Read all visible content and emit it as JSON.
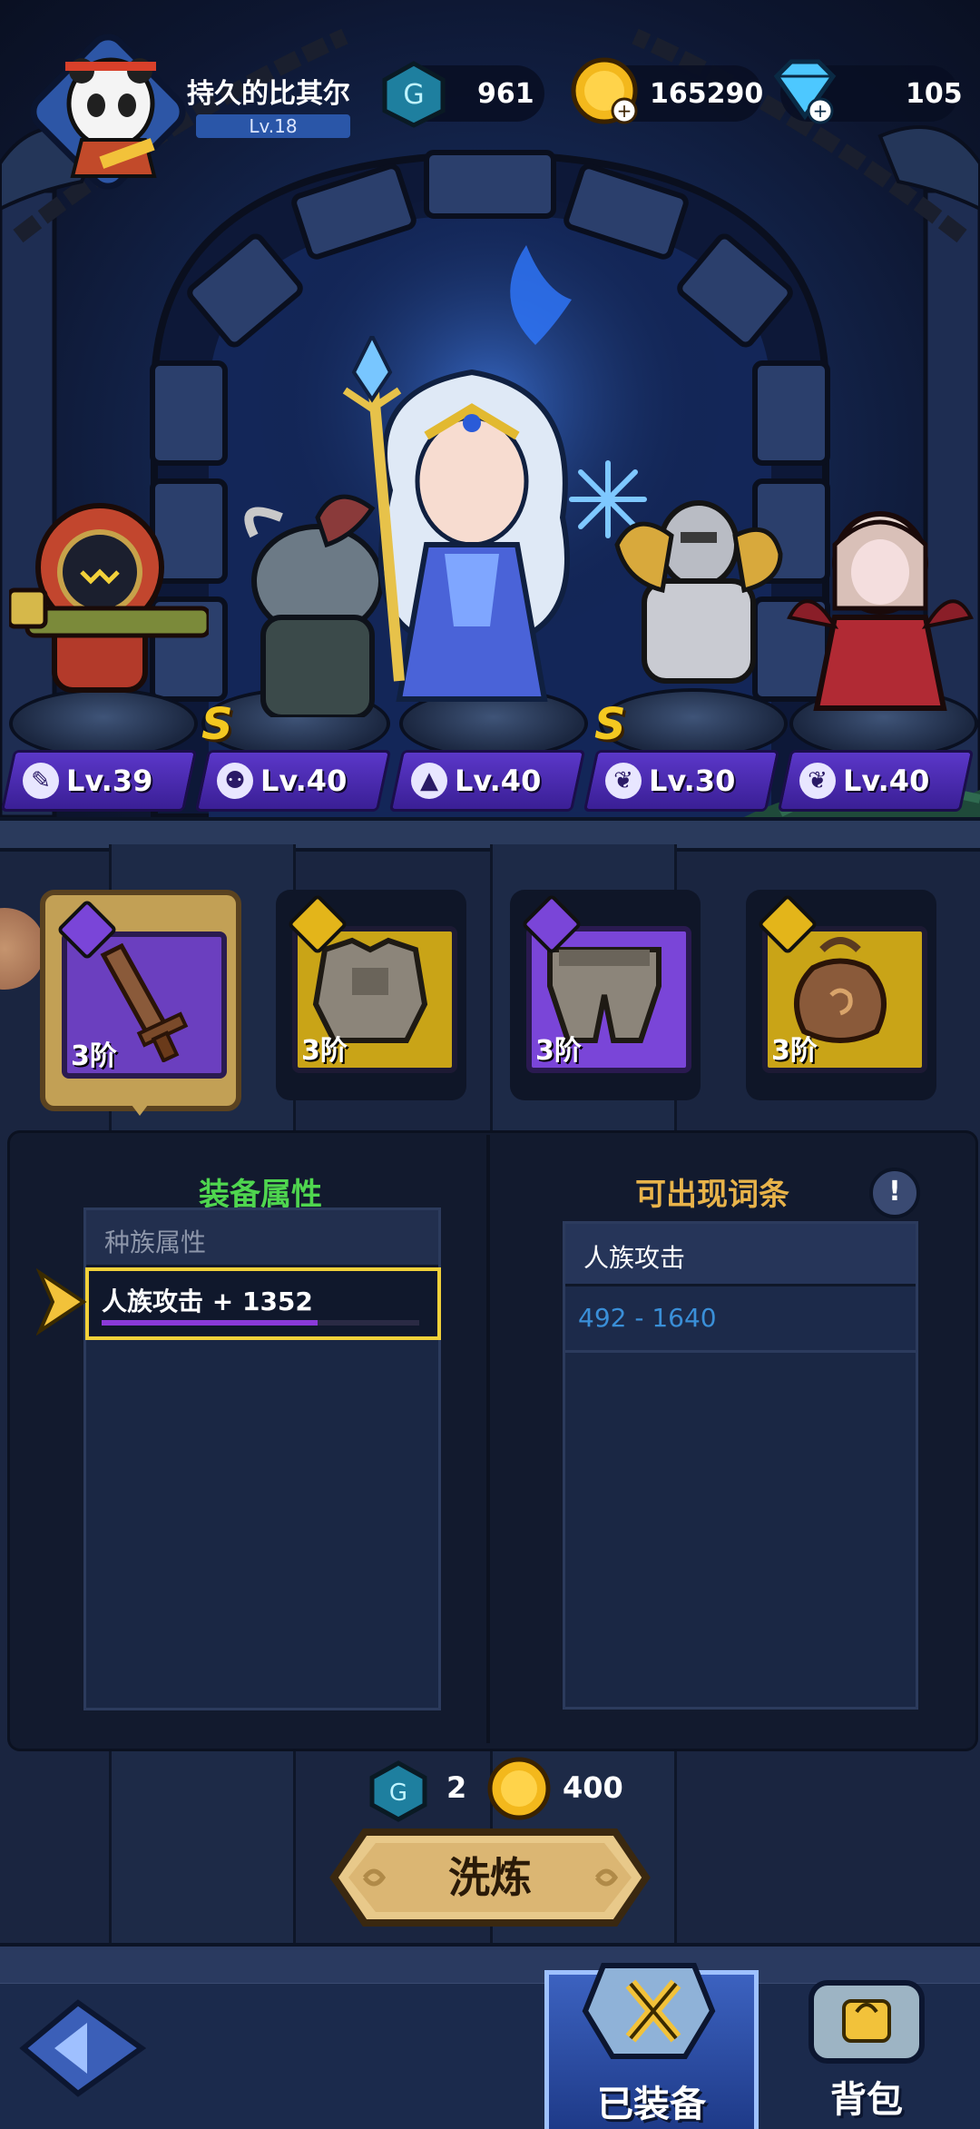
{
  "player": {
    "name": "持久的比其尔",
    "level": "Lv.18"
  },
  "resources": [
    {
      "icon": "rune-stone-icon",
      "value": "961",
      "color": "#1f8fb0"
    },
    {
      "icon": "gold-coin-icon",
      "value": "165290",
      "color": "#f3b81c"
    },
    {
      "icon": "diamond-icon",
      "value": "105",
      "color": "#4dc8ff"
    }
  ],
  "heroes": [
    {
      "level": "Lv.39",
      "class_icon": "wrench-icon",
      "badge": ""
    },
    {
      "level": "Lv.40",
      "class_icon": "beast-claw-icon",
      "badge": "S"
    },
    {
      "level": "Lv.40",
      "class_icon": "mage-hat-icon",
      "badge": ""
    },
    {
      "level": "Lv.30",
      "class_icon": "wing-icon",
      "badge": "S"
    },
    {
      "level": "Lv.40",
      "class_icon": "wing-icon",
      "badge": ""
    }
  ],
  "equipment": [
    {
      "tier": "3阶",
      "item": "wooden-sword-icon",
      "frame": "#7a45d8",
      "tag": "#7a45d8",
      "selected": true
    },
    {
      "tier": "3阶",
      "item": "chest-armor-icon",
      "frame": "#c9a417",
      "tag": "#e3b51a",
      "selected": false
    },
    {
      "tier": "3阶",
      "item": "leg-armor-icon",
      "frame": "#7a45d8",
      "tag": "#7a45d8",
      "selected": false
    },
    {
      "tier": "3阶",
      "item": "pouch-icon",
      "frame": "#c9a417",
      "tag": "#e3b51a",
      "selected": false
    }
  ],
  "attributes": {
    "title": "装备属性",
    "section": "种族属性",
    "selected_attr": "人族攻击 + 1352"
  },
  "possible": {
    "title": "可出现词条",
    "rows": [
      {
        "label": "人族攻击",
        "range": "492 - 1640"
      }
    ]
  },
  "cost": {
    "stones": "2",
    "gold": "400"
  },
  "wash_button": "洗炼",
  "nav": {
    "equipped": "已装备",
    "bag": "背包"
  },
  "colors": {
    "green_title": "#4fd64f",
    "orange_title": "#e8b34a",
    "selected_border": "#f2d13a",
    "range_text": "#3a8fd8"
  }
}
